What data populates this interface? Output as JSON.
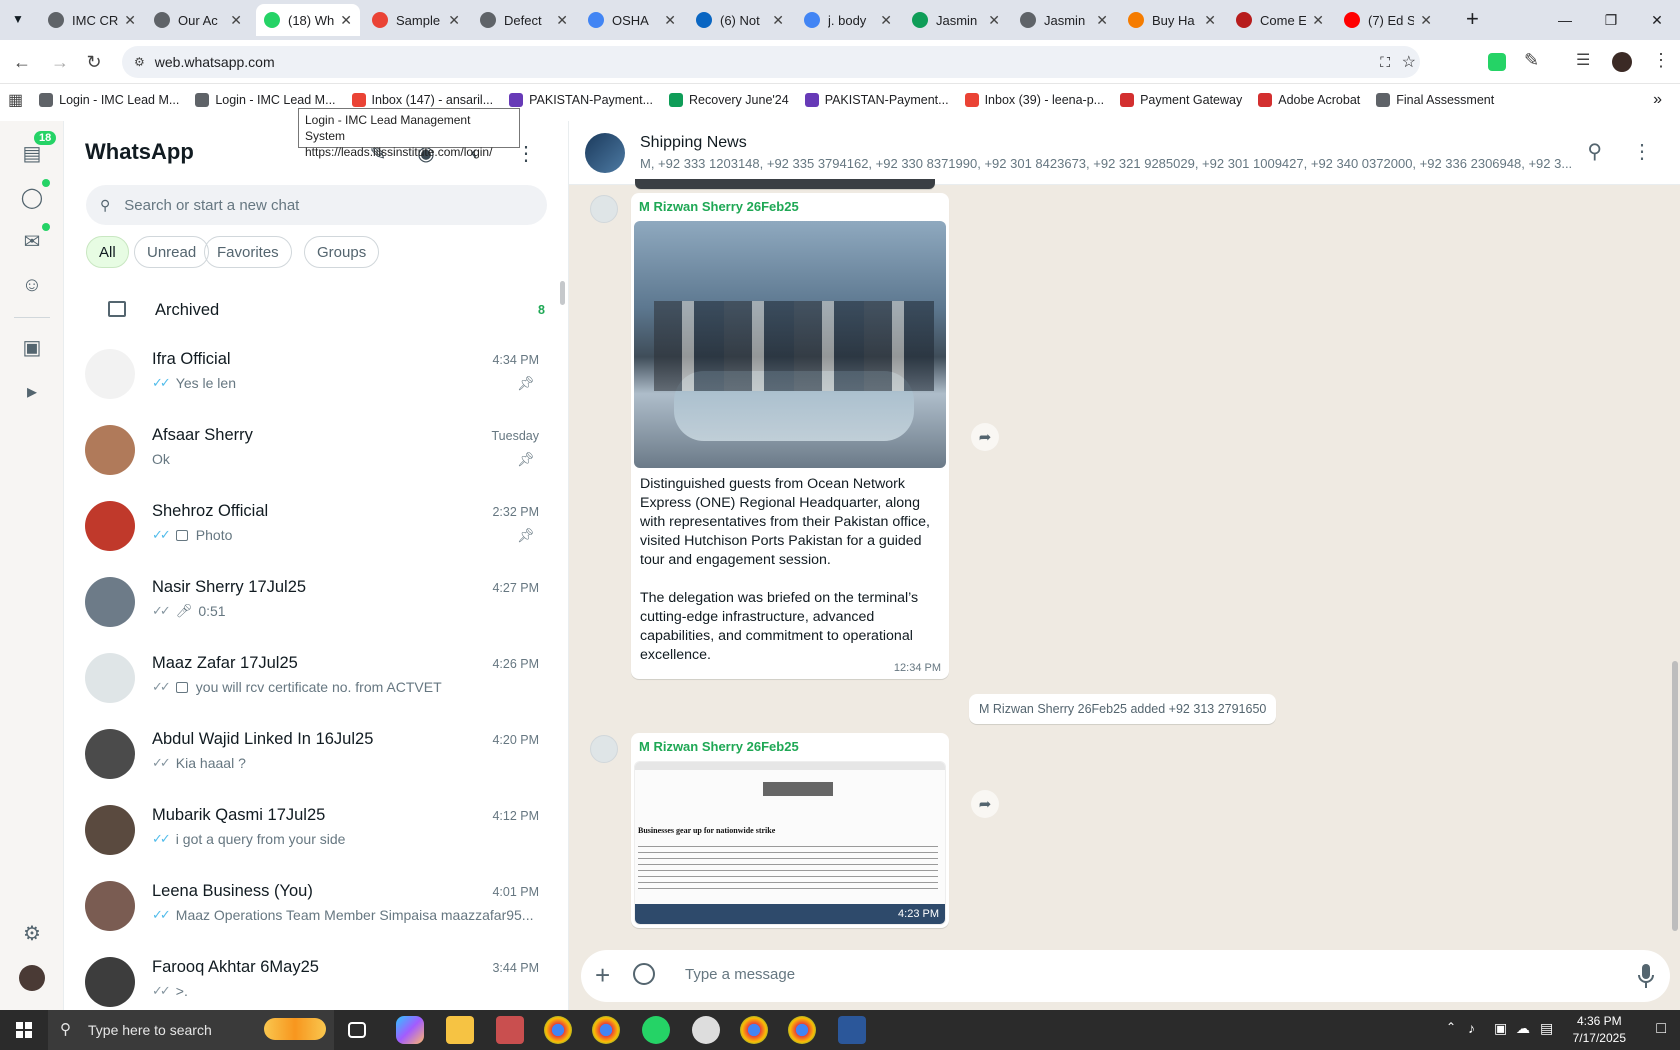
{
  "browser": {
    "tabs": [
      {
        "title": "IMC CR",
        "color": "#5f6368"
      },
      {
        "title": "Our Ac",
        "color": "#5f6368"
      },
      {
        "title": "(18) Wh",
        "color": "#25d366"
      },
      {
        "title": "Sample",
        "color": "#ea4335"
      },
      {
        "title": "Defect",
        "color": "#5f6368"
      },
      {
        "title": "OSHA",
        "color": "#4285f4"
      },
      {
        "title": "(6) Not",
        "color": "#0a66c2"
      },
      {
        "title": "j. body",
        "color": "#4285f4"
      },
      {
        "title": "Jasmin",
        "color": "#0f9d58"
      },
      {
        "title": "Jasmin",
        "color": "#5f6368"
      },
      {
        "title": "Buy Ha",
        "color": "#f57c00"
      },
      {
        "title": "Come E",
        "color": "#b71c1c"
      },
      {
        "title": "(7) Ed S",
        "color": "#ff0000"
      }
    ],
    "url": "web.whatsapp.com",
    "bookmarks": [
      {
        "label": "Login - IMC Lead M...",
        "color": "#5f6368"
      },
      {
        "label": "Login - IMC Lead M...",
        "color": "#5f6368"
      },
      {
        "label": "Inbox (147) - ansaril...",
        "color": "#ea4335"
      },
      {
        "label": "PAKISTAN-Payment...",
        "color": "#673ab7"
      },
      {
        "label": "Recovery June'24",
        "color": "#0f9d58"
      },
      {
        "label": "PAKISTAN-Payment...",
        "color": "#673ab7"
      },
      {
        "label": "Inbox (39) - leena-p...",
        "color": "#ea4335"
      },
      {
        "label": "Payment Gateway",
        "color": "#d32f2f"
      },
      {
        "label": "Adobe Acrobat",
        "color": "#d32f2f"
      },
      {
        "label": "Final Assessment",
        "color": "#5f6368"
      }
    ],
    "tooltip": {
      "line1": "Login - IMC Lead Management System",
      "line2": "https://leads.iilssinstitute.com/login/"
    }
  },
  "whatsapp": {
    "rail": {
      "badge": "18"
    },
    "title": "WhatsApp",
    "search_placeholder": "Search or start a new chat",
    "filters": [
      "All",
      "Unread",
      "Favorites",
      "Groups"
    ],
    "archived": {
      "label": "Archived",
      "count": "8"
    },
    "chats": [
      {
        "name": "Ifra Official",
        "time": "4:34 PM",
        "preview": "Yes le len",
        "tick": "blue",
        "media": "",
        "pinned": true,
        "avatar": "#f2f2f2"
      },
      {
        "name": "Afsaar Sherry",
        "time": "Tuesday",
        "preview": "Ok",
        "tick": "",
        "media": "",
        "pinned": true,
        "avatar": "#b07a5a"
      },
      {
        "name": "Shehroz Official",
        "time": "2:32 PM",
        "preview": "Photo",
        "tick": "blue",
        "media": "photo",
        "pinned": true,
        "avatar": "#c0392b"
      },
      {
        "name": "Nasir Sherry 17Jul25",
        "time": "4:27 PM",
        "preview": "0:51",
        "tick": "grey",
        "media": "mic",
        "pinned": false,
        "avatar": "#6d7b88"
      },
      {
        "name": "Maaz Zafar 17Jul25",
        "time": "4:26 PM",
        "preview": "you will rcv certificate no. from ACTVET",
        "tick": "grey",
        "media": "photo",
        "pinned": false,
        "avatar": "#dfe5e7"
      },
      {
        "name": "Abdul Wajid Linked In 16Jul25",
        "time": "4:20 PM",
        "preview": "Kia haaal ?",
        "tick": "grey",
        "media": "",
        "pinned": false,
        "avatar": "#4b4b4b"
      },
      {
        "name": "Mubarik Qasmi 17Jul25",
        "time": "4:12 PM",
        "preview": "i got a query from your side",
        "tick": "blue",
        "media": "",
        "pinned": false,
        "avatar": "#5a4a3f"
      },
      {
        "name": "Leena Business (You)",
        "time": "4:01 PM",
        "preview": "Maaz Operations Team Member Simpaisa maazzafar95...",
        "tick": "blue",
        "media": "",
        "pinned": false,
        "avatar": "#7a5c52"
      },
      {
        "name": "Farooq Akhtar 6May25",
        "time": "3:44 PM",
        "preview": ">.",
        "tick": "grey",
        "media": "",
        "pinned": false,
        "avatar": "#3d3d3d"
      }
    ],
    "conversation": {
      "name": "Shipping News",
      "members": "M, +92 333 1203148, +92 335 3794162, +92 330 8371990, +92 301 8423673, +92 321 9285029, +92 301 1009427, +92 340 0372000, +92 336 2306948, +92 3...",
      "messages": [
        {
          "sender": "M Rizwan Sherry 26Feb25",
          "text": "Distinguished guests from Ocean Network Express (ONE) Regional Headquarter, along with representatives from their Pakistan office, visited Hutchison Ports Pakistan for a guided tour and engagement session.\n\nThe delegation was briefed on the terminal’s cutting-edge infrastructure, advanced capabilities, and commitment to operational excellence.",
          "time": "12:34 PM"
        },
        {
          "sender": "M Rizwan Sherry 26Feb25",
          "headline": "Businesses gear up for nationwide strike",
          "time": "4:23 PM"
        }
      ],
      "system_message": "M Rizwan Sherry 26Feb25 added +92 313 2791650",
      "composer_placeholder": "Type a message"
    }
  },
  "taskbar": {
    "search_placeholder": "Type here to search",
    "time": "4:36 PM",
    "date": "7/17/2025"
  }
}
